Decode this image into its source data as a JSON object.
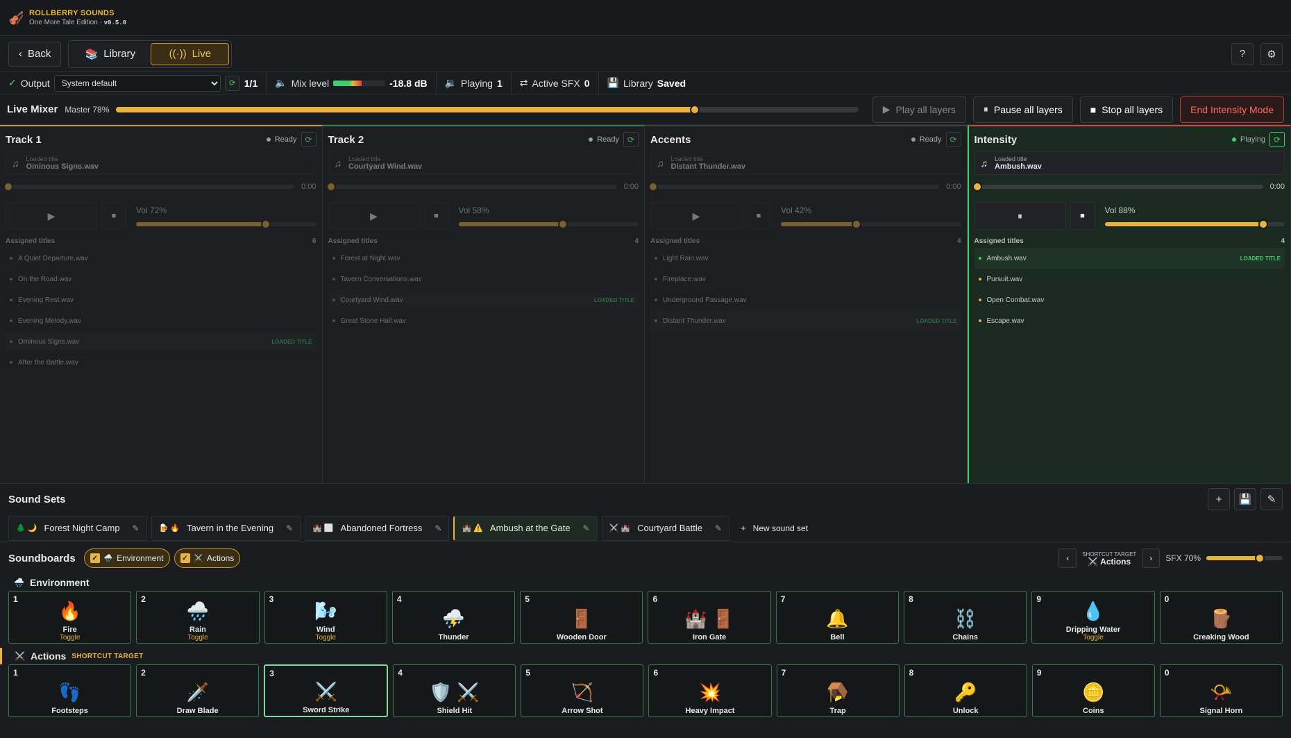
{
  "app": {
    "name": "ROLLBERRY SOUNDS",
    "edition": "One More Tale Edition",
    "version": "v0.5.0"
  },
  "nav": {
    "back": "Back",
    "library": "Library",
    "live": "Live"
  },
  "status": {
    "output_label": "Output",
    "output_value": "System default",
    "output_count": "1/1",
    "mix_label": "Mix level",
    "mix_value": "-18.8 dB",
    "mix_fraction": 0.55,
    "playing_label": "Playing",
    "playing_value": "1",
    "sfx_label": "Active SFX",
    "sfx_value": "0",
    "library_label": "Library",
    "library_value": "Saved"
  },
  "mixer": {
    "title": "Live Mixer",
    "master_label": "Master 78%",
    "master_value": 0.78,
    "play_all": "Play all layers",
    "pause_all": "Pause all layers",
    "stop_all": "Stop all layers",
    "end_intensity": "End Intensity Mode"
  },
  "tracks": [
    {
      "title": "Track 1",
      "state": "Ready",
      "loaded_label": "Loaded title",
      "loaded": "Ominous Signs.wav",
      "time": "0:00",
      "vol_label": "Vol 72%",
      "vol": 0.72,
      "assigned_label": "Assigned titles",
      "count": "6",
      "items": [
        {
          "name": "A Quiet Departure.wav"
        },
        {
          "name": "On the Road.wav"
        },
        {
          "name": "Evening Rest.wav"
        },
        {
          "name": "Evening Melody.wav"
        },
        {
          "name": "Ominous Signs.wav",
          "tag": "LOADED TITLE"
        },
        {
          "name": "After the Battle.wav"
        }
      ]
    },
    {
      "title": "Track 2",
      "state": "Ready",
      "loaded_label": "Loaded title",
      "loaded": "Courtyard Wind.wav",
      "time": "0:00",
      "vol_label": "Vol 58%",
      "vol": 0.58,
      "assigned_label": "Assigned titles",
      "count": "4",
      "items": [
        {
          "name": "Forest at Night.wav"
        },
        {
          "name": "Tavern Conversations.wav"
        },
        {
          "name": "Courtyard Wind.wav",
          "tag": "LOADED TITLE"
        },
        {
          "name": "Great Stone Hall.wav"
        }
      ]
    },
    {
      "title": "Accents",
      "state": "Ready",
      "loaded_label": "Loaded title",
      "loaded": "Distant Thunder.wav",
      "time": "0:00",
      "vol_label": "Vol 42%",
      "vol": 0.42,
      "assigned_label": "Assigned titles",
      "count": "4",
      "items": [
        {
          "name": "Light Rain.wav"
        },
        {
          "name": "Fireplace.wav"
        },
        {
          "name": "Underground Passage.wav"
        },
        {
          "name": "Distant Thunder.wav",
          "tag": "LOADED TITLE"
        }
      ]
    },
    {
      "title": "Intensity",
      "state": "Playing",
      "loaded_label": "Loaded title",
      "loaded": "Ambush.wav",
      "time": "0:00",
      "vol_label": "Vol 88%",
      "vol": 0.88,
      "assigned_label": "Assigned titles",
      "count": "4",
      "items": [
        {
          "name": "Ambush.wav",
          "tag": "LOADED TITLE"
        },
        {
          "name": "Pursuit.wav"
        },
        {
          "name": "Open Combat.wav"
        },
        {
          "name": "Escape.wav"
        }
      ]
    }
  ],
  "soundsets": {
    "title": "Sound Sets",
    "new": "New sound set",
    "sets": [
      {
        "icons": "🌲 🌙",
        "name": "Forest Night Camp"
      },
      {
        "icons": "🍺 🔥",
        "name": "Tavern in the Evening"
      },
      {
        "icons": "🏰 ⬜",
        "name": "Abandoned Fortress"
      },
      {
        "icons": "🏰 ⚠️",
        "name": "Ambush at the Gate",
        "active": true
      },
      {
        "icons": "⚔️ 🏰",
        "name": "Courtyard Battle"
      }
    ]
  },
  "soundboards": {
    "title": "Soundboards",
    "filters": [
      {
        "icon": "🌧️",
        "label": "Environment"
      },
      {
        "icon": "⚔️",
        "label": "Actions"
      }
    ],
    "shortcut_label": "SHORTCUT TARGET",
    "shortcut_value": "Actions",
    "sfx_label": "SFX 70%",
    "sfx_value": 0.7
  },
  "boards": [
    {
      "icon": "🌧️",
      "title": "Environment",
      "sub": "",
      "pads": [
        {
          "n": "1",
          "e": "🔥",
          "name": "Fire",
          "tag": "Toggle"
        },
        {
          "n": "2",
          "e": "🌧️",
          "name": "Rain",
          "tag": "Toggle"
        },
        {
          "n": "3",
          "e": "🌬️",
          "name": "Wind",
          "tag": "Toggle"
        },
        {
          "n": "4",
          "e": "⛈️",
          "name": "Thunder"
        },
        {
          "n": "5",
          "e": "🚪",
          "name": "Wooden Door"
        },
        {
          "n": "6",
          "e": "🏰 🚪",
          "name": "Iron Gate"
        },
        {
          "n": "7",
          "e": "🔔",
          "name": "Bell"
        },
        {
          "n": "8",
          "e": "⛓️",
          "name": "Chains"
        },
        {
          "n": "9",
          "e": "💧",
          "name": "Dripping Water",
          "tag": "Toggle"
        },
        {
          "n": "0",
          "e": "🪵",
          "name": "Creaking Wood"
        }
      ]
    },
    {
      "icon": "⚔️",
      "title": "Actions",
      "sub": "SHORTCUT TARGET",
      "pads": [
        {
          "n": "1",
          "e": "👣",
          "name": "Footsteps"
        },
        {
          "n": "2",
          "e": "🗡️",
          "name": "Draw Blade"
        },
        {
          "n": "3",
          "e": "⚔️",
          "name": "Sword Strike",
          "sel": true
        },
        {
          "n": "4",
          "e": "🛡️ ⚔️",
          "name": "Shield Hit"
        },
        {
          "n": "5",
          "e": "🏹",
          "name": "Arrow Shot"
        },
        {
          "n": "6",
          "e": "💥",
          "name": "Heavy Impact"
        },
        {
          "n": "7",
          "e": "🪤",
          "name": "Trap"
        },
        {
          "n": "8",
          "e": "🔑",
          "name": "Unlock"
        },
        {
          "n": "9",
          "e": "🪙",
          "name": "Coins"
        },
        {
          "n": "0",
          "e": "📯",
          "name": "Signal Horn"
        }
      ]
    }
  ]
}
